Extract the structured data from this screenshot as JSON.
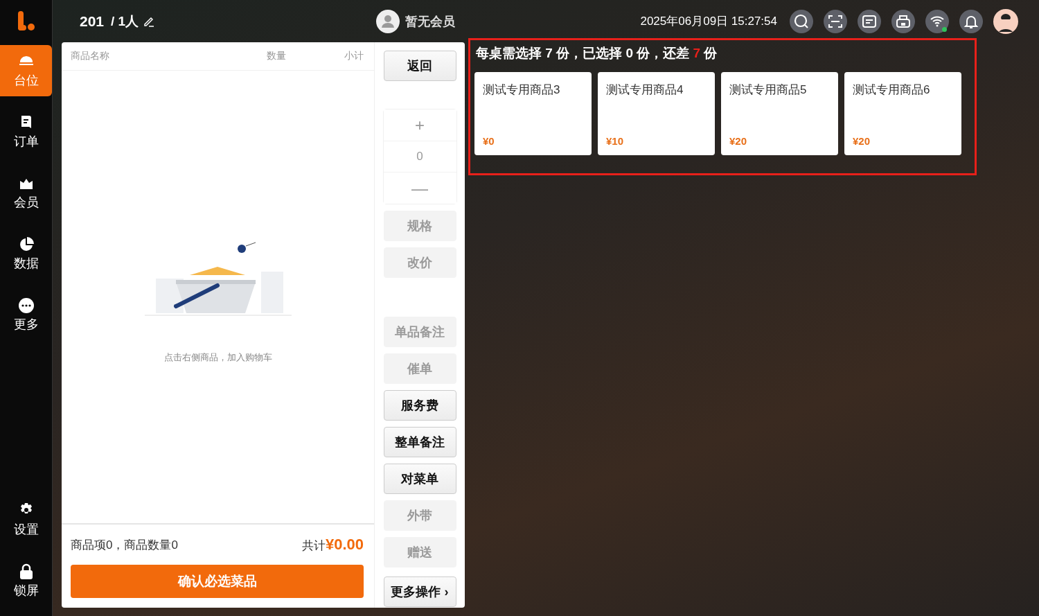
{
  "sidebar": {
    "items": [
      {
        "kind": "table",
        "label": "台位",
        "selected": true
      },
      {
        "kind": "order",
        "label": "订单",
        "selected": false
      },
      {
        "kind": "member",
        "label": "会员",
        "selected": false
      },
      {
        "kind": "data",
        "label": "数据",
        "selected": false
      },
      {
        "kind": "more",
        "label": "更多",
        "selected": false
      }
    ],
    "bottom_items": [
      {
        "kind": "settings",
        "label": "设置",
        "selected": false
      },
      {
        "kind": "lock",
        "label": "锁屏",
        "selected": false
      }
    ]
  },
  "header": {
    "table_number": "201",
    "guests": "/ 1人",
    "member": "暂无会员",
    "datetime": "2025年06月09日 15:27:54",
    "wifi_connected": true
  },
  "cart": {
    "columns": [
      "商品名称",
      "数量",
      "小计"
    ],
    "empty_message": "点击右侧商品，加入购物车",
    "summary": "商品项0，商品数量0",
    "total_label": "共计",
    "total": "¥0.00",
    "confirm_button": "确认必选菜品"
  },
  "stepper": {
    "plus": "+",
    "value": "0",
    "minus": "—",
    "disabled": true
  },
  "actions": [
    {
      "kind": "button",
      "label": "返回",
      "disabled": false
    },
    {
      "kind": "stepper"
    },
    {
      "kind": "button",
      "label": "规格",
      "disabled": true
    },
    {
      "kind": "button",
      "label": "改价",
      "disabled": true
    },
    {
      "kind": "gap"
    },
    {
      "kind": "button",
      "label": "单品备注",
      "disabled": true
    },
    {
      "kind": "button",
      "label": "催单",
      "disabled": true
    },
    {
      "kind": "button",
      "label": "服务费",
      "disabled": false
    },
    {
      "kind": "button",
      "label": "整单备注",
      "disabled": false
    },
    {
      "kind": "button",
      "label": "对菜单",
      "disabled": false
    },
    {
      "kind": "button",
      "label": "外带",
      "disabled": true
    },
    {
      "kind": "button",
      "label": "赠送",
      "disabled": true
    },
    {
      "kind": "more",
      "label": "更多操作",
      "chevron": "›",
      "disabled": false
    }
  ],
  "required_selection": {
    "prefix": "每桌需选择 7 份，已选择 0 份，还差 ",
    "shortfall": "7",
    "suffix": " 份",
    "products": [
      {
        "name": "测试专用商品3",
        "price": "¥0"
      },
      {
        "name": "测试专用商品4",
        "price": "¥10"
      },
      {
        "name": "测试专用商品5",
        "price": "¥20"
      },
      {
        "name": "测试专用商品6",
        "price": "¥20"
      }
    ]
  }
}
